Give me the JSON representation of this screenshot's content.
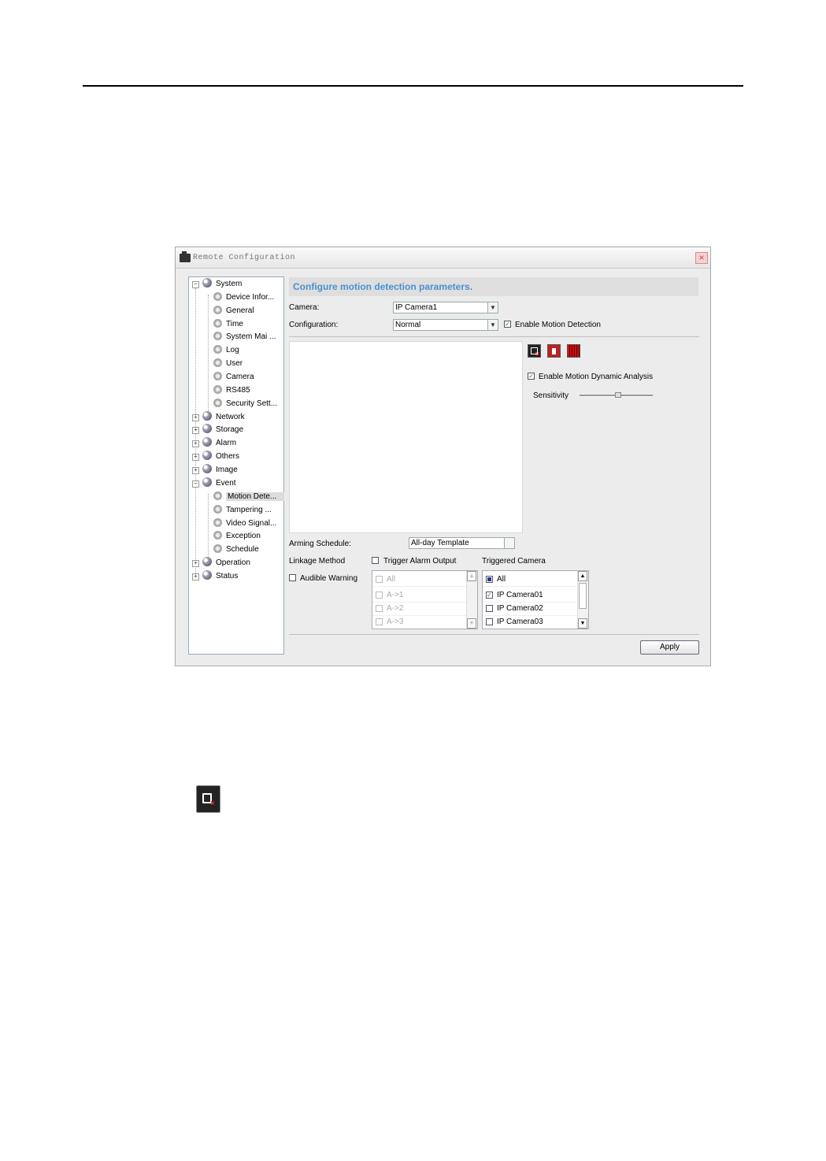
{
  "window": {
    "title": "Remote Configuration",
    "close_glyph": "×"
  },
  "tree": {
    "items": [
      {
        "label": "System",
        "type": "group",
        "expander": "−"
      },
      {
        "label": "Device Infor...",
        "type": "leaf"
      },
      {
        "label": "General",
        "type": "leaf"
      },
      {
        "label": "Time",
        "type": "leaf"
      },
      {
        "label": "System Mai ...",
        "type": "leaf"
      },
      {
        "label": "Log",
        "type": "leaf"
      },
      {
        "label": "User",
        "type": "leaf"
      },
      {
        "label": "Camera",
        "type": "leaf"
      },
      {
        "label": "RS485",
        "type": "leaf"
      },
      {
        "label": "Security Sett...",
        "type": "leaf"
      },
      {
        "label": "Network",
        "type": "group",
        "expander": "+"
      },
      {
        "label": "Storage",
        "type": "group",
        "expander": "+"
      },
      {
        "label": "Alarm",
        "type": "group",
        "expander": "+"
      },
      {
        "label": "Others",
        "type": "group",
        "expander": "+"
      },
      {
        "label": "Image",
        "type": "group",
        "expander": "+"
      },
      {
        "label": "Event",
        "type": "group",
        "expander": "−"
      },
      {
        "label": "Motion Dete...",
        "type": "leaf",
        "selected": true
      },
      {
        "label": "Tampering ...",
        "type": "leaf"
      },
      {
        "label": "Video Signal...",
        "type": "leaf"
      },
      {
        "label": "Exception",
        "type": "leaf"
      },
      {
        "label": "Schedule",
        "type": "leaf"
      },
      {
        "label": "Operation",
        "type": "group",
        "expander": "+"
      },
      {
        "label": "Status",
        "type": "group",
        "expander": "+"
      }
    ]
  },
  "main": {
    "header": "Configure motion detection parameters.",
    "camera_label": "Camera:",
    "camera_value": "IP Camera1",
    "configuration_label": "Configuration:",
    "configuration_value": "Normal",
    "enable_motion_detection": "Enable Motion Detection",
    "enable_motion_detection_checked": true,
    "enable_dynamic_analysis": "Enable Motion Dynamic Analysis",
    "enable_dynamic_analysis_checked": true,
    "sensitivity_label": "Sensitivity",
    "sensitivity_level": 0.5,
    "arming_schedule_label": "Arming Schedule:",
    "arming_schedule_value": "All-day Template",
    "linkage_method_label": "Linkage Method",
    "trigger_alarm_output": "Trigger Alarm Output",
    "audible_warning": "Audible Warning",
    "triggered_camera_label": "Triggered Camera",
    "alarm_outputs": [
      "All",
      "A->1",
      "A->2",
      "A->3"
    ],
    "cameras": [
      {
        "label": "All",
        "state": "partial"
      },
      {
        "label": "IP Camera01",
        "state": "checked"
      },
      {
        "label": "IP Camera02",
        "state": "unchecked"
      },
      {
        "label": "IP Camera03",
        "state": "unchecked"
      }
    ],
    "apply_label": "Apply",
    "check_glyph": "✓",
    "arrow_down": "▼",
    "arrow_up": "▲"
  },
  "colors": {
    "header_text": "#4a90d0",
    "delete_tool": "#b22222",
    "check": "#2a7a2a"
  }
}
